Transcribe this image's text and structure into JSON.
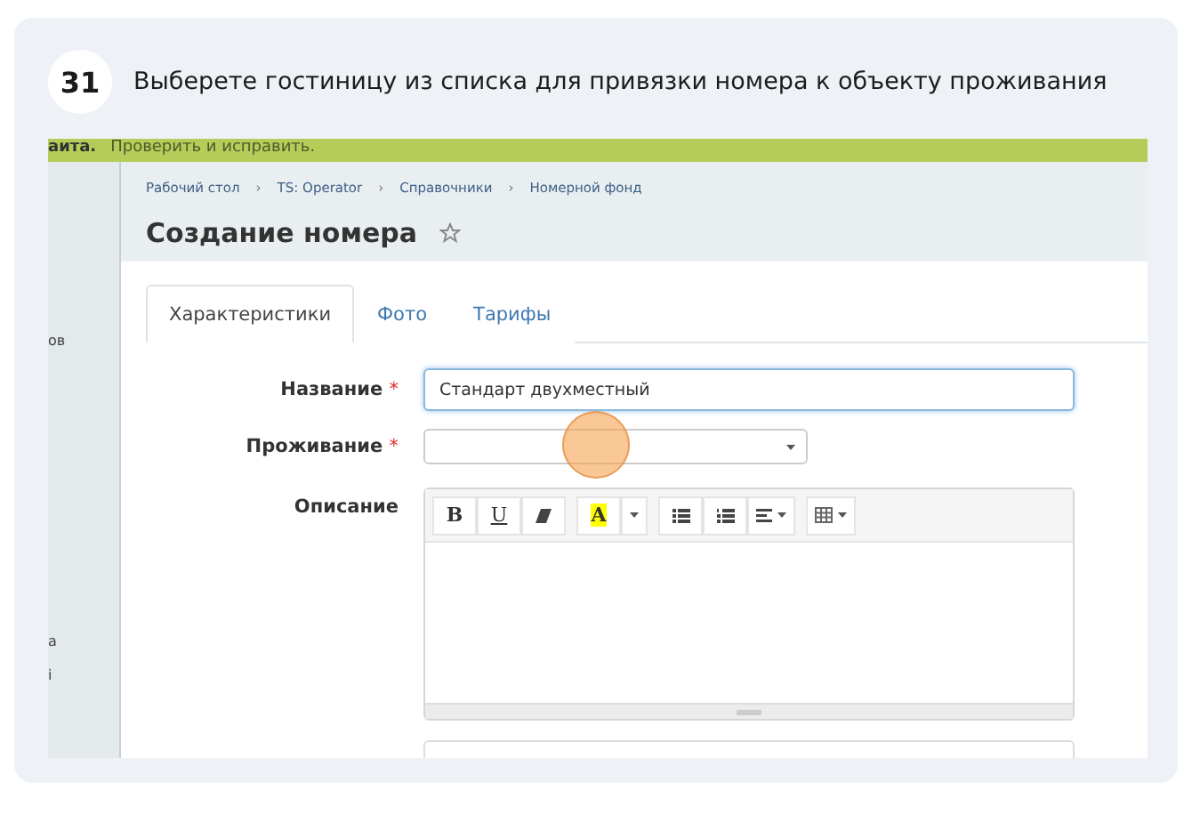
{
  "step": {
    "number": "31",
    "instruction": "Выберете гостиницу из списка для привязки номера к объекту проживания"
  },
  "notice": {
    "prefix": "аита.",
    "text": "Проверить и исправить."
  },
  "sidebar": {
    "items": [
      "ов",
      "а",
      "і"
    ]
  },
  "breadcrumbs": [
    "Рабочий стол",
    "TS: Operator",
    "Справочники",
    "Номерной фонд"
  ],
  "breadcrumb_separator": "›",
  "page_title": "Создание номера",
  "favorite": {
    "on": false
  },
  "tabs": [
    {
      "label": "Характеристики",
      "selected": true
    },
    {
      "label": "Фото",
      "selected": false
    },
    {
      "label": "Тарифы",
      "selected": false
    }
  ],
  "form": {
    "required_mark": "*",
    "name": {
      "label": "Название",
      "value": "Стандарт двухместный",
      "focused": true
    },
    "accommodation": {
      "label": "Проживание"
    },
    "description": {
      "label": "Описание"
    }
  },
  "toolbar": [
    {
      "kind": "bold",
      "label": "B"
    },
    {
      "kind": "underline",
      "label": "U"
    },
    {
      "kind": "eraser"
    },
    {
      "kind": "highlight",
      "label": "A"
    },
    {
      "kind": "caret"
    },
    {
      "kind": "bullets"
    },
    {
      "kind": "numbers"
    },
    {
      "kind": "align"
    },
    {
      "kind": "table"
    }
  ],
  "click_marker": {
    "on": true
  }
}
